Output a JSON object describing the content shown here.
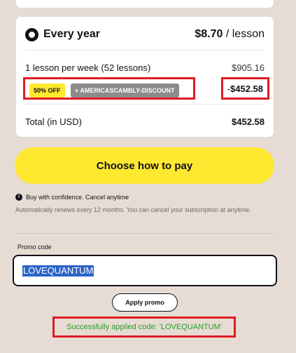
{
  "plan": {
    "name": "Every year",
    "price_value": "$8.70",
    "price_unit": "/ lesson",
    "lessons_label": "1 lesson per week (52 lessons)",
    "lessons_amount": "$905.16",
    "discount_badge": "50% OFF",
    "code_badge": "+ AMERICASCAMBLY-DISCOUNT",
    "discount_sign": "-",
    "discount_amount": "$452.58",
    "total_label": "Total (in USD)",
    "total_amount": "$452.58"
  },
  "pay_button_label": "Choose how to pay",
  "confidence": {
    "icon": "info-icon",
    "text": "Buy with confidence. Cancel anytime"
  },
  "renew_note": "Automatically renews every 12 months. You can cancel your subscription at anytime.",
  "promo": {
    "label": "Promo code",
    "value": "LOVEQUANTUM",
    "apply_label": "Apply promo",
    "success_message": "Successfully applied code: 'LOVEQUANTUM'"
  },
  "colors": {
    "background": "#e6dcd3",
    "accent_yellow": "#ffe930",
    "highlight_red": "#e01b24",
    "success_green": "#2a9d2a",
    "selection_blue": "#2b63c8"
  }
}
